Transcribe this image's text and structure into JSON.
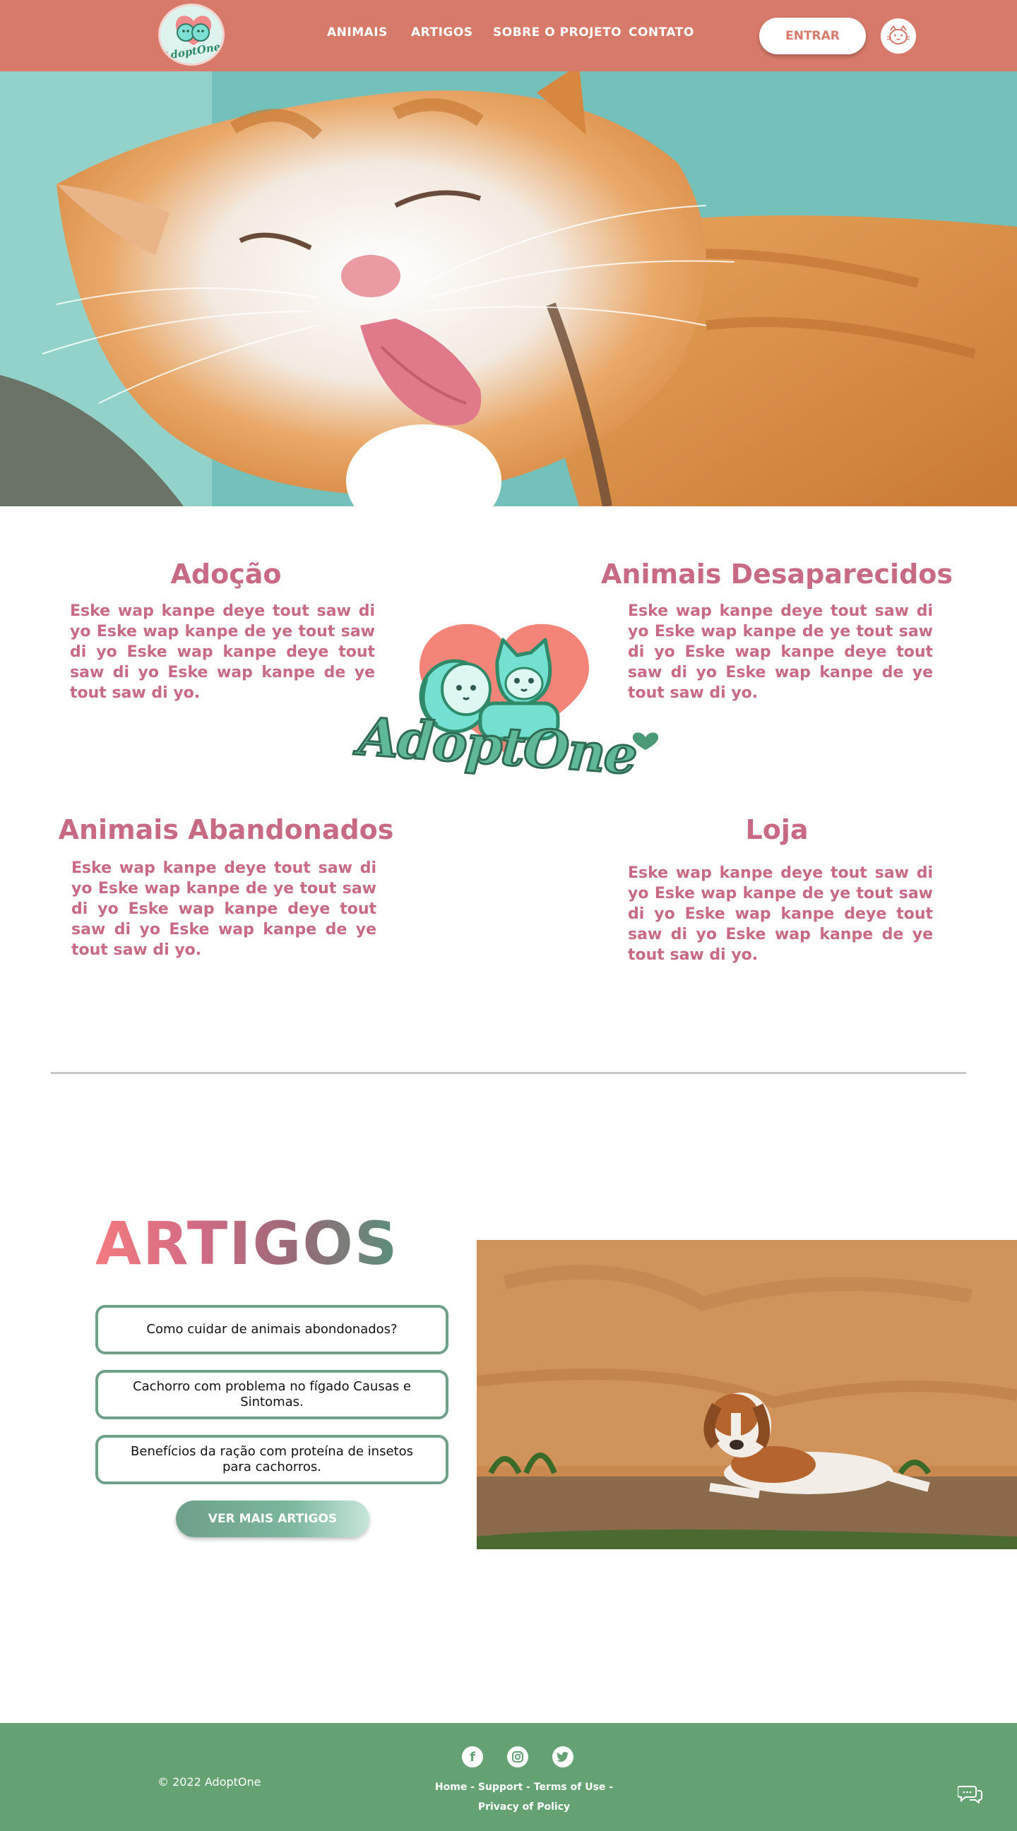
{
  "header": {
    "logo_text": "AdoptOne",
    "nav": [
      "ANIMAIS",
      "ARTIGOS",
      "SOBRE O PROJETO",
      "CONTATO"
    ],
    "login_label": "ENTRAR"
  },
  "center_logo_text": "AdoptOne",
  "features": [
    {
      "title": "Adoção",
      "text": "Eske wap kanpe deye tout saw di yo Eske wap kanpe de ye tout saw di yo Eske wap kanpe deye tout saw di yo Eske wap kanpe de ye tout saw di yo."
    },
    {
      "title": "Animais Desaparecidos",
      "text": "Eske wap kanpe deye tout saw di yo Eske wap kanpe de ye tout saw di yo Eske wap kanpe deye tout saw di yo Eske wap kanpe de ye tout saw di yo."
    },
    {
      "title": "Animais Abandonados",
      "text": "Eske wap kanpe deye tout saw di yo Eske wap kanpe de ye tout saw di yo Eske wap kanpe deye tout saw di yo Eske wap kanpe de ye tout saw di yo."
    },
    {
      "title": "Loja",
      "text": "Eske wap kanpe deye tout saw di yo Eske wap kanpe de ye tout saw di yo Eske wap kanpe deye tout saw di yo Eske wap kanpe de ye tout saw di yo."
    }
  ],
  "artigos": {
    "title": "ARTIGOS",
    "items": [
      "Como cuidar de animais abondonados?",
      "Cachorro com problema no fígado Causas e Sintomas.",
      "Benefícios da ração com proteína de insetos para cachorros."
    ],
    "more_label": "VER MAIS ARTIGOS"
  },
  "footer": {
    "copyright": "© 2022 AdoptOne",
    "links": [
      "Home",
      "Support",
      "Terms of Use",
      "Privacy of Policy"
    ]
  },
  "colors": {
    "header": "#d87a6a",
    "accent_pink": "#c86a84",
    "accent_green": "#6ea08a",
    "footer": "#64a274"
  },
  "icons": [
    "facebook-icon",
    "instagram-icon",
    "twitter-icon",
    "chat-icon",
    "cat-avatar-icon"
  ]
}
